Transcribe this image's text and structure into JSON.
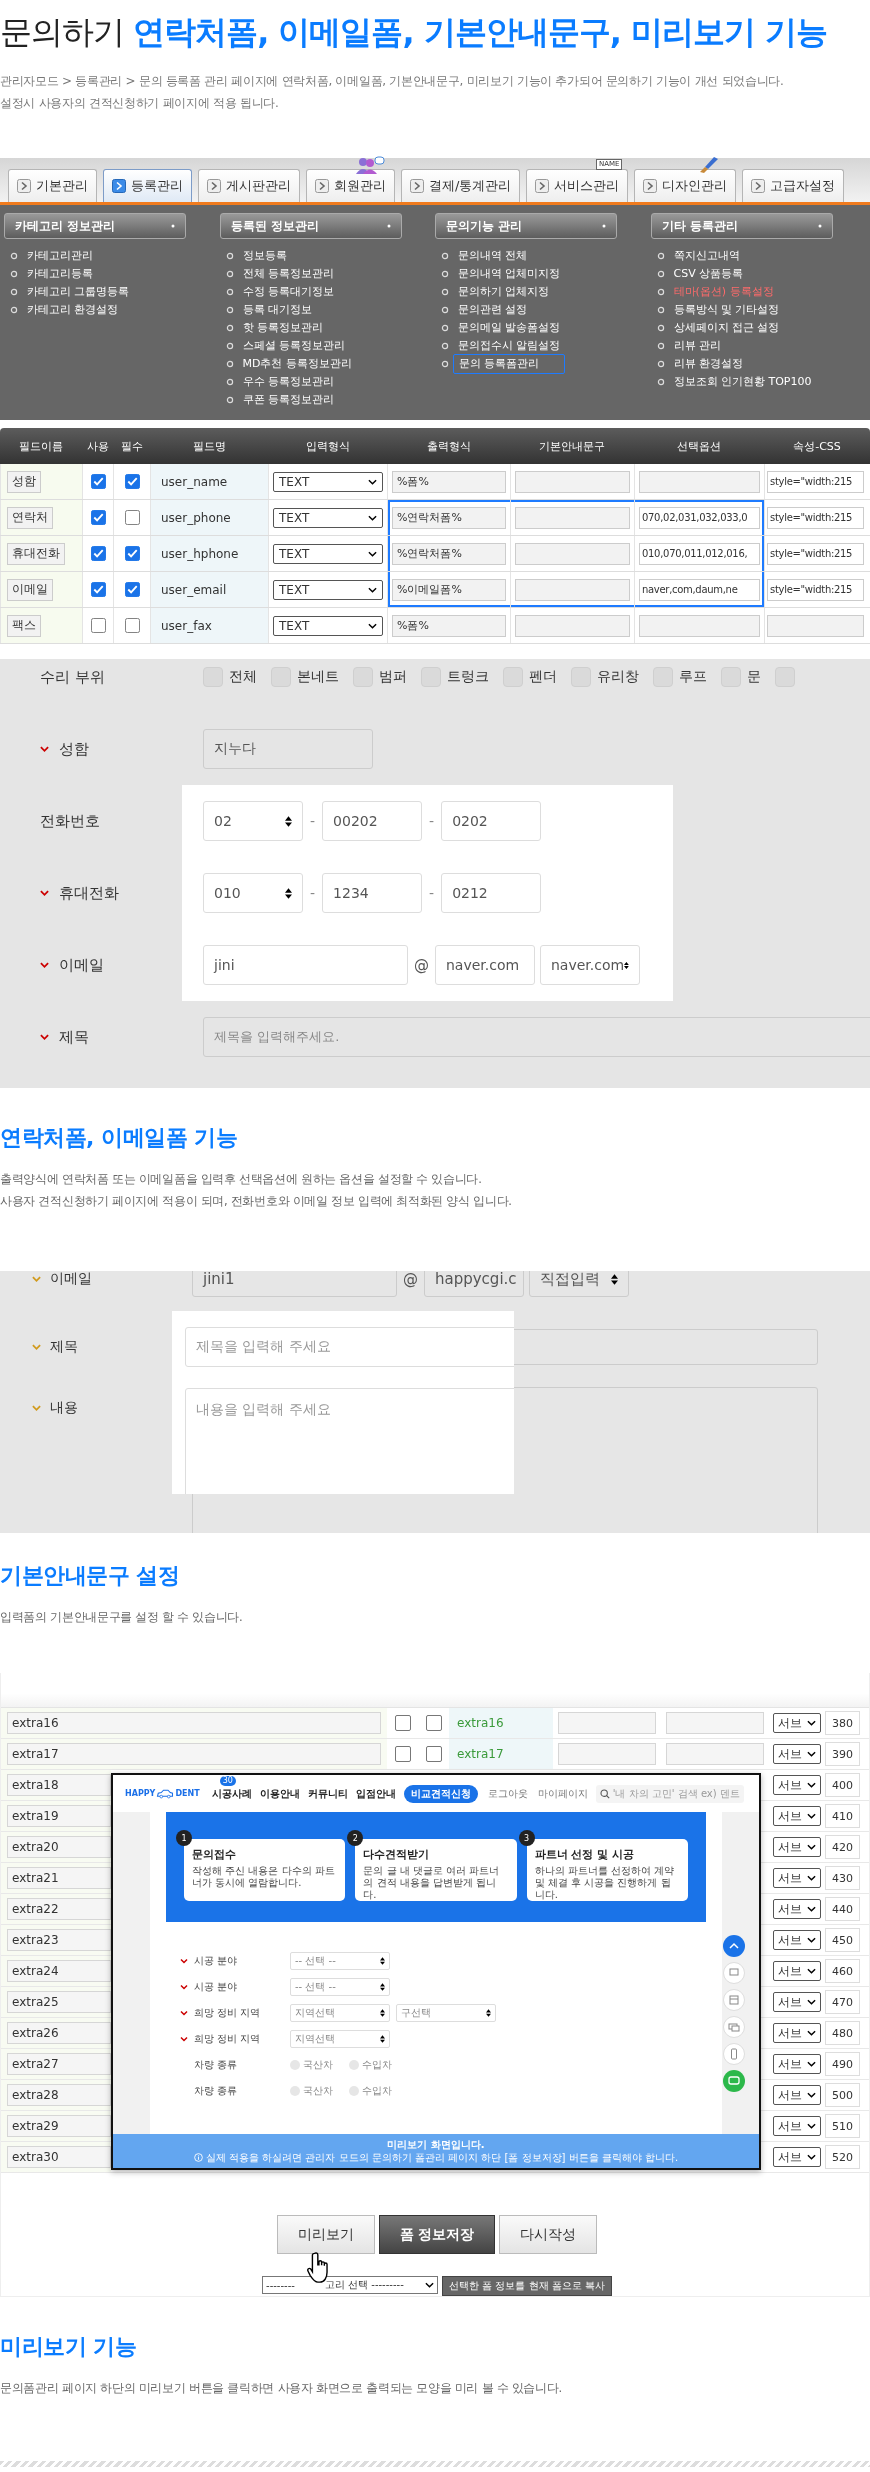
{
  "header": {
    "title_lead": "문의하기",
    "title_main": "연락처폼, 이메일폼, 기본안내문구, 미리보기 기능",
    "lines": [
      "관리자모드 > 등록관리 > 문의 등록폼 관리 페이지에 연락처폼, 이메일폼, 기본안내문구, 미리보기 기능이 추가되어 문의하기 기능이 개선 되었습니다.",
      "설정시 사용자의 견적신청하기 페이지에 적용 됩니다."
    ]
  },
  "admin": {
    "tabs": [
      {
        "label": "기본관리",
        "selected": false,
        "kind": "plain"
      },
      {
        "label": "등록관리",
        "selected": true,
        "kind": "plain"
      },
      {
        "label": "게시판관리",
        "selected": false,
        "kind": "plain"
      },
      {
        "label": "회원관리",
        "selected": false,
        "kind": "people"
      },
      {
        "label": "결제/통계관리",
        "selected": false,
        "kind": "plain"
      },
      {
        "label": "서비스관리",
        "selected": false,
        "kind": "name-tag",
        "tag": "NAME"
      },
      {
        "label": "디자인관리",
        "selected": false,
        "kind": "brush"
      },
      {
        "label": "고급자설정",
        "selected": false,
        "kind": "plain"
      }
    ],
    "menus": [
      {
        "title": "카테고리 정보관리",
        "items": [
          {
            "label": "카테고리관리",
            "selected": false,
            "alert": false
          },
          {
            "label": "카테고리등록",
            "selected": false,
            "alert": false
          },
          {
            "label": "카테고리 그룹명등록",
            "selected": false,
            "alert": false
          },
          {
            "label": "카테고리 환경설정",
            "selected": false,
            "alert": false
          }
        ]
      },
      {
        "title": "등록된 정보관리",
        "items": [
          {
            "label": "정보등록",
            "selected": false,
            "alert": false
          },
          {
            "label": "전체 등록정보관리",
            "selected": false,
            "alert": false
          },
          {
            "label": "수정 등록대기정보",
            "selected": false,
            "alert": false
          },
          {
            "label": "등록 대기정보",
            "selected": false,
            "alert": false
          },
          {
            "label": "핫 등록정보관리",
            "selected": false,
            "alert": false
          },
          {
            "label": "스페셜 등록정보관리",
            "selected": false,
            "alert": false
          },
          {
            "label": "MD추천 등록정보관리",
            "selected": false,
            "alert": false
          },
          {
            "label": "우수 등록정보관리",
            "selected": false,
            "alert": false
          },
          {
            "label": "쿠폰 등록정보관리",
            "selected": false,
            "alert": false
          }
        ]
      },
      {
        "title": "문의기능 관리",
        "items": [
          {
            "label": "문의내역 전체",
            "selected": false,
            "alert": false
          },
          {
            "label": "문의내역 업체미지정",
            "selected": false,
            "alert": false
          },
          {
            "label": "문의하기 업체지정",
            "selected": false,
            "alert": false
          },
          {
            "label": "문의관련 설정",
            "selected": false,
            "alert": false
          },
          {
            "label": "문의메일 발송폼설정",
            "selected": false,
            "alert": false
          },
          {
            "label": "문의접수시 알림설정",
            "selected": false,
            "alert": false
          },
          {
            "label": "문의 등록폼관리",
            "selected": true,
            "alert": false
          }
        ]
      },
      {
        "title": "기타 등록관리",
        "items": [
          {
            "label": "쪽지신고내역",
            "selected": false,
            "alert": false
          },
          {
            "label": "CSV 상품등록",
            "selected": false,
            "alert": false
          },
          {
            "label": "테마(옵션) 등록설정",
            "selected": false,
            "alert": true
          },
          {
            "label": "등록방식 및 기타설정",
            "selected": false,
            "alert": false
          },
          {
            "label": "상세페이지 접근 설정",
            "selected": false,
            "alert": false
          },
          {
            "label": "리뷰 관리",
            "selected": false,
            "alert": false
          },
          {
            "label": "리뷰 환경설정",
            "selected": false,
            "alert": false
          },
          {
            "label": "정보조회 인기현황 TOP100",
            "selected": false,
            "alert": false
          }
        ]
      }
    ]
  },
  "fields": {
    "columns": [
      "필드이름",
      "사용",
      "필수",
      "필드명",
      "입력형식",
      "출력형식",
      "기본안내문구",
      "선택옵션",
      "속성-CSS"
    ],
    "rows": [
      {
        "label": "성함",
        "used": true,
        "required": true,
        "name": "user_name",
        "input_type": "TEXT",
        "output": "%폼%",
        "css": "style=\"width:215",
        "highlighted": false
      },
      {
        "label": "연락처",
        "used": true,
        "required": false,
        "name": "user_phone",
        "input_type": "TEXT",
        "output": "%연락처폼%",
        "options": "070,02,031,032,033,0",
        "css": "style=\"width:215",
        "highlighted": true
      },
      {
        "label": "휴대전화",
        "used": true,
        "required": true,
        "name": "user_hphone",
        "input_type": "TEXT",
        "output": "%연락처폼%",
        "options": "010,070,011,012,016,",
        "css": "style=\"width:215",
        "highlighted": true
      },
      {
        "label": "이메일",
        "used": true,
        "required": true,
        "name": "user_email",
        "input_type": "TEXT",
        "output": "%이메일폼%",
        "options": "naver,com,daum,ne",
        "css": "style=\"width:215",
        "highlighted": true
      },
      {
        "label": "팩스",
        "used": false,
        "required": false,
        "name": "user_fax",
        "input_type": "TEXT",
        "output": "%폼%",
        "highlighted": false
      }
    ]
  },
  "inquiry_form": {
    "rows": [
      {
        "kind": "checks",
        "label": "수리 부위",
        "required": false,
        "highlighted": false,
        "options": [
          {
            "label": "전체",
            "checked": false
          },
          {
            "label": "본네트",
            "checked": false
          },
          {
            "label": "범퍼",
            "checked": false
          },
          {
            "label": "트렁크",
            "checked": false
          },
          {
            "label": "펜더",
            "checked": false
          },
          {
            "label": "유리창",
            "checked": false
          },
          {
            "label": "루프",
            "checked": false
          },
          {
            "label": "문",
            "checked": false
          },
          {
            "checked": false
          }
        ]
      },
      {
        "kind": "text",
        "label": "성함",
        "required": true,
        "highlighted": false,
        "value": "지누다"
      },
      {
        "kind": "phone",
        "label": "전화번호",
        "required": false,
        "highlighted": true,
        "prefix": "02",
        "middle": "00202",
        "last": "0202",
        "separator": "-"
      },
      {
        "kind": "phone",
        "label": "휴대전화",
        "required": true,
        "highlighted": true,
        "prefix": "010",
        "middle": "1234",
        "last": "0212",
        "separator": "-"
      },
      {
        "kind": "email",
        "label": "이메일",
        "required": true,
        "highlighted": true,
        "user": "jini",
        "at": "@",
        "domain": "naver.com",
        "domain_choice": "naver.com"
      },
      {
        "kind": "wide-text",
        "label": "제목",
        "required": true,
        "highlighted": false,
        "placeholder": "제목을 입력해주세요."
      }
    ]
  },
  "contact_section": {
    "title": "연락처폼, 이메일폼 기능",
    "lines": [
      "출력양식에 연락처폼 또는 이메일폼을 입력후 선택옵션에 원하는 옵션을 설정할 수 있습니다.",
      "사용자 견적신청하기 페이지에 적용이 되며, 전화번호와 이메일 정보 입력에 최적화된 양식 입니다."
    ]
  },
  "email_form": {
    "email": {
      "label": "이메일",
      "user": "jini1",
      "at": "@",
      "domain": "happycgi.c",
      "domain_choice": "직접입력"
    },
    "subject_label": "제목",
    "content_label": "내용",
    "popup": {
      "subject_placeholder": "제목을 입력해 주세요",
      "content_placeholder": "내용을 입력해 주세요"
    }
  },
  "guide_section": {
    "title": "기본안내문구 설정",
    "lines": [
      "입력폼의 기본안내문구를 설정 할 수 있습니다."
    ]
  },
  "extras": {
    "rows": [
      {
        "name": "extra16",
        "used": false,
        "required": false,
        "field": "extra16",
        "group": "서브",
        "order": "380"
      },
      {
        "name": "extra17",
        "used": false,
        "required": false,
        "field": "extra17",
        "group": "서브",
        "order": "390"
      },
      {
        "name": "extra18",
        "group": "서브",
        "order": "400"
      },
      {
        "name": "extra19",
        "group": "서브",
        "order": "410"
      },
      {
        "name": "extra20",
        "group": "서브",
        "order": "420"
      },
      {
        "name": "extra21",
        "group": "서브",
        "order": "430"
      },
      {
        "name": "extra22",
        "group": "서브",
        "order": "440"
      },
      {
        "name": "extra23",
        "group": "서브",
        "order": "450"
      },
      {
        "name": "extra24",
        "group": "서브",
        "order": "460"
      },
      {
        "name": "extra25",
        "group": "서브",
        "order": "470"
      },
      {
        "name": "extra26",
        "group": "서브",
        "order": "480"
      },
      {
        "name": "extra27",
        "group": "서브",
        "order": "490"
      },
      {
        "name": "extra28",
        "group": "서브",
        "order": "500"
      },
      {
        "name": "extra29",
        "group": "서브",
        "order": "510"
      },
      {
        "name": "extra30",
        "group": "서브",
        "order": "520"
      }
    ],
    "preview": {
      "logo_left": "HAPPY",
      "logo_right": "DENT",
      "nav": [
        {
          "label": "시공사례",
          "badge": "30"
        },
        {
          "label": "이용안내"
        },
        {
          "label": "커뮤니티"
        },
        {
          "label": "입점안내"
        }
      ],
      "cta": "비교견적신청",
      "links": [
        "로그아웃",
        "마이페이지"
      ],
      "search_placeholder": "'내 차의 고민' 검색 ex) 덴트",
      "steps": [
        {
          "number": "1",
          "title": "문의접수",
          "text": "작성해 주신 내용은 다수의 파트너가 동시에 열람합니다."
        },
        {
          "number": "2",
          "title": "다수견적받기",
          "text": "문의 글 내 댓글로 여러 파트너의 견적 내용을 답변받게 됩니다."
        },
        {
          "number": "3",
          "title": "파트너 선정 및 시공",
          "text": "하나의 파트너를 선정하여 계약 및 체결 후 시공을 진행하게 됩니다."
        }
      ],
      "rows": [
        {
          "label": "시공 분야",
          "required": true,
          "kind": "select",
          "choices": [
            "-- 선택 --"
          ]
        },
        {
          "label": "시공 분야",
          "required": true,
          "kind": "select",
          "choices": [
            "-- 선택 --"
          ]
        },
        {
          "label": "희망 정비 지역",
          "required": true,
          "kind": "select",
          "choices": [
            "지역선택",
            "구선택"
          ]
        },
        {
          "label": "희망 정비 지역",
          "required": true,
          "kind": "select",
          "choices": [
            "지역선택"
          ]
        },
        {
          "label": "차량 종류",
          "required": false,
          "kind": "radio",
          "choices": [
            {
              "label": "국산차",
              "selected": false
            },
            {
              "label": "수입차",
              "selected": false
            }
          ]
        },
        {
          "label": "차량 종류",
          "required": false,
          "kind": "radio",
          "choices": [
            {
              "label": "국산차",
              "selected": false
            },
            {
              "label": "수입차",
              "selected": false
            }
          ]
        }
      ],
      "notice_title": "미리보기 화면입니다.",
      "notice_text": "실제 적용을 하실려면 관리자 모드의 문의하기 폼관리 페이지 하단 [폼 정보저장] 버튼을 클릭해야 합니다."
    },
    "buttons": [
      {
        "label": "미리보기",
        "kind": "normal"
      },
      {
        "label": "폼 정보저장",
        "kind": "primary"
      },
      {
        "label": "다시작성",
        "kind": "normal"
      }
    ],
    "copy": {
      "select_left": "--------",
      "select_right": "고리 선택 ---------",
      "button": "선택한 폼 정보를 현재 폼으로 복사"
    }
  },
  "preview_section": {
    "title": "미리보기 기능",
    "lines": [
      "문의폼관리 페이지 하단의 미리보기 버튼을 클릭하면 사용자 화면으로 출력되는 모양을 미리 볼 수 있습니다."
    ]
  }
}
